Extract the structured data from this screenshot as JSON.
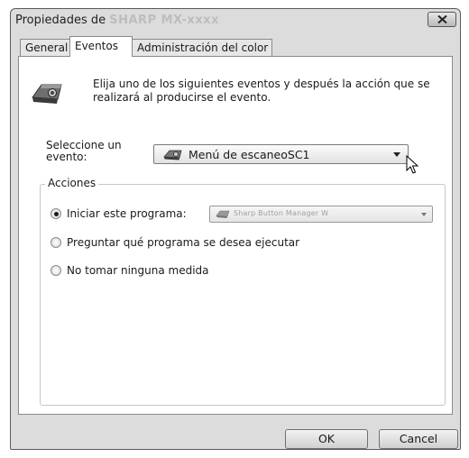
{
  "window": {
    "title_prefix": "Propiedades de",
    "title_device": "SHARP MX-xxxx"
  },
  "tabs": [
    {
      "label": "General"
    },
    {
      "label": "Eventos",
      "active": true
    },
    {
      "label": "Administración del color"
    }
  ],
  "intro": {
    "icon": "scanner-icon",
    "text": "Elija uno de los siguientes eventos y después la acción que se realizará al producirse el evento."
  },
  "event_select": {
    "label": "Seleccione un evento:",
    "value": "Menú de escaneoSC1",
    "icon": "scanner-icon"
  },
  "actions": {
    "group_label": "Acciones",
    "options": [
      {
        "label": "Iniciar este programa:",
        "checked": true
      },
      {
        "label": "Preguntar qué programa se desea ejecutar",
        "checked": false
      },
      {
        "label": "No tomar ninguna medida",
        "checked": false
      }
    ],
    "program_value": "Sharp Button Manager W"
  },
  "buttons": {
    "ok": "OK",
    "cancel": "Cancel"
  }
}
